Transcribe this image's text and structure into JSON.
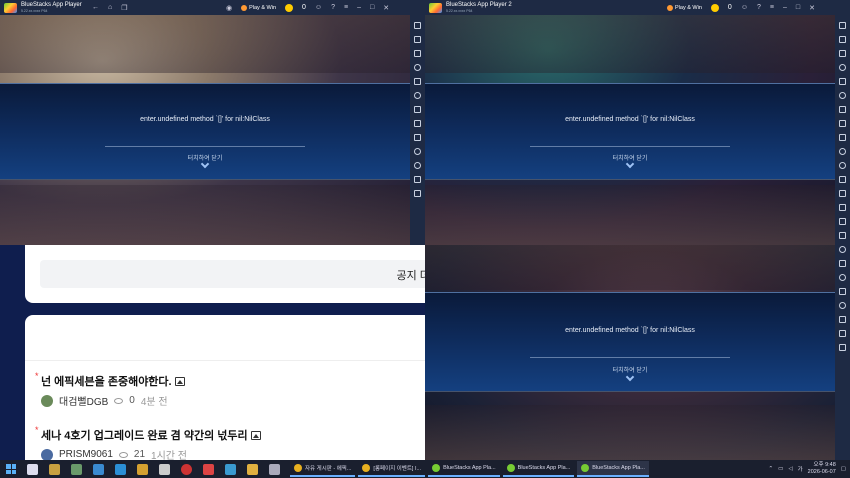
{
  "browser": {
    "notice_button": "공지 더보",
    "posts": [
      {
        "title": "넌 에픽세븐을 존중해야한다.",
        "author": "대검뻘DGB",
        "views": "0",
        "time": "4분 전",
        "avatar_color": "#6a8a5a"
      },
      {
        "title": "세나 4호기 업그레이드 완료 겸 약간의 넋두리",
        "author": "PRISM9061",
        "views": "21",
        "time": "1시간 전",
        "avatar_color": "#4a6aa0"
      }
    ]
  },
  "windows": [
    {
      "title": "BlueStacks App Player",
      "subtitle": "5.22.xx.xxxx P64",
      "play_win": "Play & Win",
      "coins": "0"
    },
    {
      "title": "BlueStacks App Player 2",
      "subtitle": "5.22.xx.xxxx P64",
      "play_win": "Play & Win",
      "coins": "0"
    }
  ],
  "dialog": {
    "message": "enter.undefined method `[]' for nil:NilClass",
    "close_label": "터치하여 닫기"
  },
  "taskbar": {
    "tasks": [
      {
        "label": "자유 게시판 - 에픽...",
        "icon_color": "#e8b020",
        "active": false
      },
      {
        "label": "[롱페이지 이벤트] I...",
        "icon_color": "#e8b020",
        "active": false
      },
      {
        "label": "BlueStacks App Pla...",
        "icon_color": "#7c3",
        "active": false
      },
      {
        "label": "BlueStacks App Pla...",
        "icon_color": "#7c3",
        "active": false
      },
      {
        "label": "BlueStacks App Pla...",
        "icon_color": "#7c3",
        "active": true
      }
    ],
    "clock_time": "오후 9:48",
    "clock_date": "2026-06-07"
  }
}
